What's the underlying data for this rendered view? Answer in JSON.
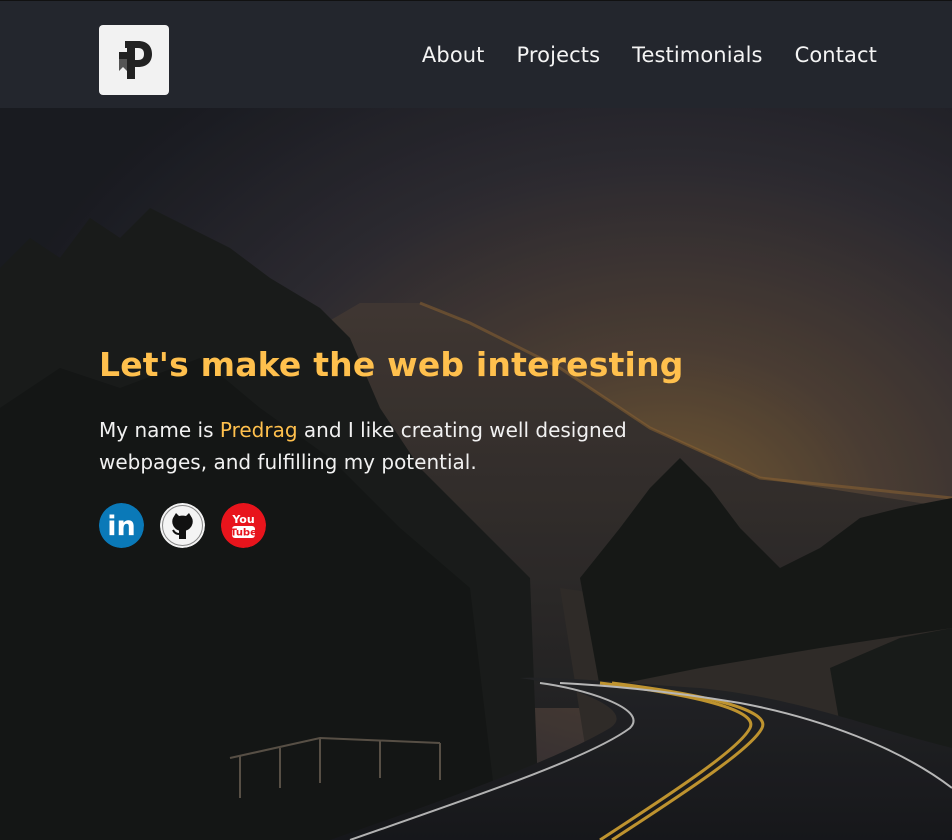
{
  "header": {
    "logo_letter": "P",
    "nav": [
      "About",
      "Projects",
      "Testimonials",
      "Contact"
    ]
  },
  "hero": {
    "headline": "Let's make the web interesting",
    "intro_before": "My name is ",
    "intro_name": "Predrag",
    "intro_after": " and I like creating well designed webpages, and fulfilling my potential.",
    "social": [
      {
        "name": "linkedin-icon",
        "label": "in"
      },
      {
        "name": "github-icon",
        "label": ""
      },
      {
        "name": "youtube-icon",
        "label_top": "You",
        "label_bottom": "Tube"
      }
    ]
  },
  "colors": {
    "accent": "#ffc04d",
    "header_bg": "#23262d",
    "linkedin": "#0a79b8",
    "youtube": "#e8141c"
  }
}
